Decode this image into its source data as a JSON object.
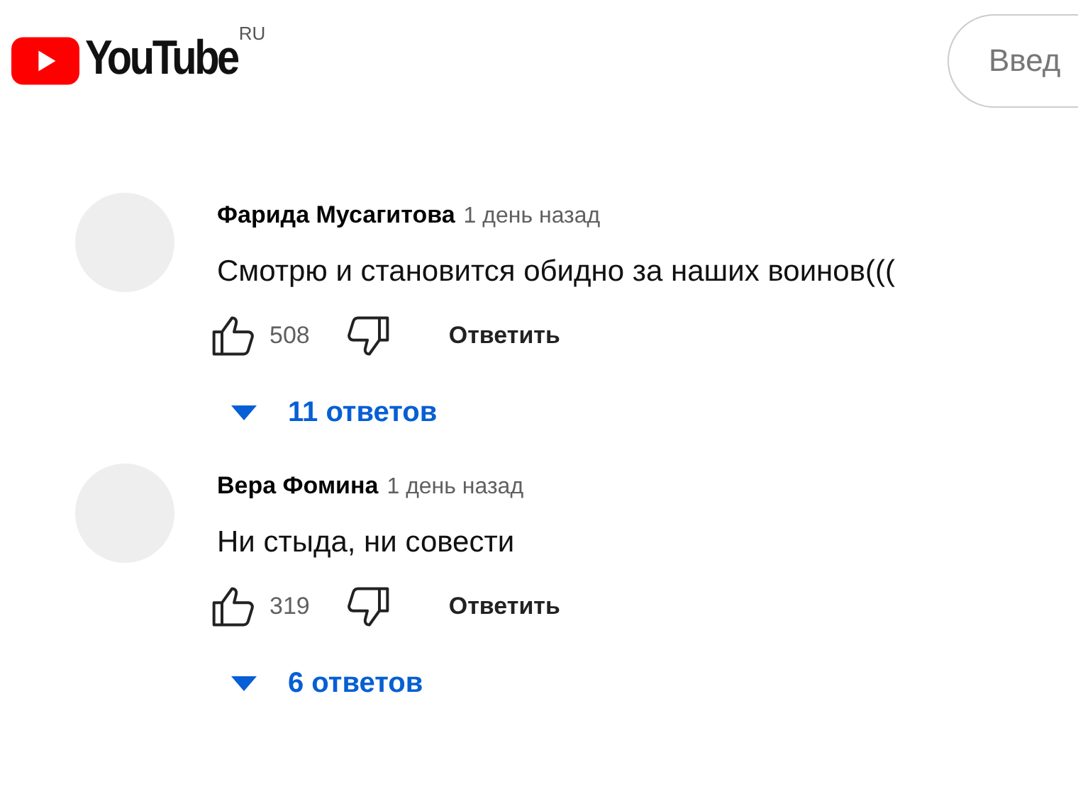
{
  "header": {
    "logo": "YouTube",
    "region": "RU",
    "search": {
      "placeholder": "Введ"
    }
  },
  "comments": [
    {
      "author": "Фарида Мусагитова",
      "time": "1 день назад",
      "text": "Смотрю и становится обидно за наших воинов(((",
      "likes": "508",
      "reply": "Ответить",
      "replies": "11 ответов"
    },
    {
      "author": "Вера Фомина",
      "time": "1 день назад",
      "text": "Ни стыда, ни совести",
      "likes": "319",
      "reply": "Ответить",
      "replies": "6 ответов"
    }
  ]
}
